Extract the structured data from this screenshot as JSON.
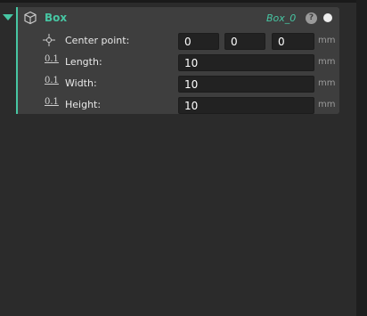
{
  "panel": {
    "title": "Box",
    "object_name": "Box_0",
    "help_glyph": "?",
    "accent_color": "#47c6a3",
    "icons": {
      "collapse": "triangle-down-icon",
      "object": "box-icon",
      "help": "help-icon",
      "status": "status-dot"
    }
  },
  "rows": {
    "center": {
      "label": "Center point:",
      "icon": "crosshair-icon",
      "x": "0",
      "y": "0",
      "z": "0",
      "unit": "mm"
    },
    "length": {
      "label": "Length:",
      "icon": "numeric-icon",
      "icon_text": "0.1",
      "value": "10",
      "unit": "mm"
    },
    "width": {
      "label": "Width:",
      "icon": "numeric-icon",
      "icon_text": "0.1",
      "value": "10",
      "unit": "mm"
    },
    "height": {
      "label": "Height:",
      "icon": "numeric-icon",
      "icon_text": "0.1",
      "value": "10",
      "unit": "mm"
    }
  }
}
